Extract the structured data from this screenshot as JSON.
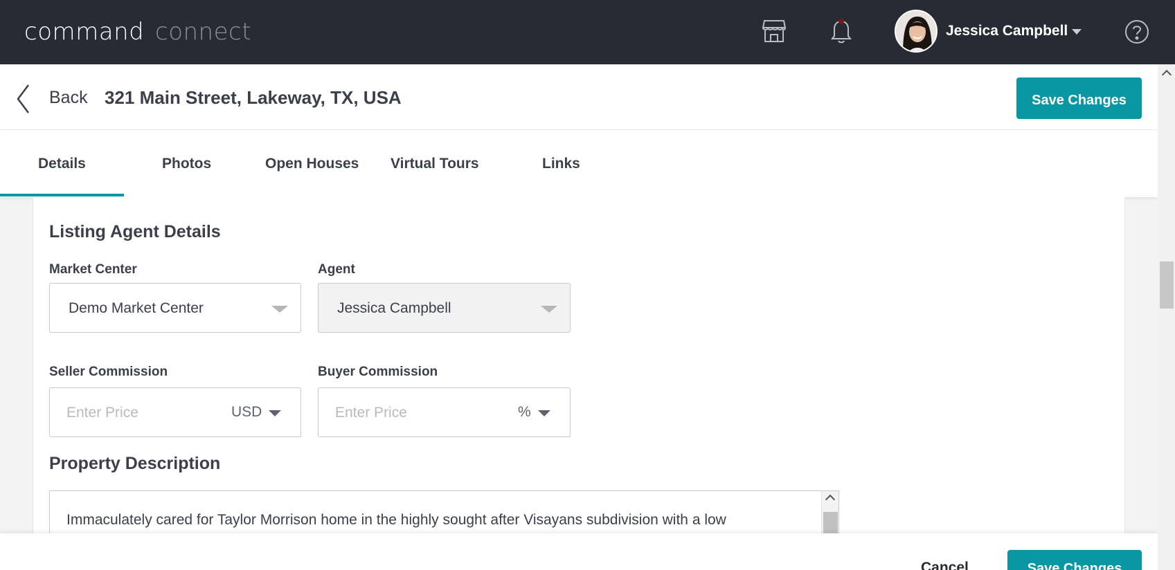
{
  "topbar": {
    "brand_primary": "command",
    "brand_secondary": "connect",
    "user_name": "Jessica Campbell"
  },
  "header": {
    "back_label": "Back",
    "address": "321 Main Street, Lakeway, TX, USA",
    "save_label": "Save Changes"
  },
  "tabs": [
    {
      "label": "Details",
      "active": true
    },
    {
      "label": "Photos"
    },
    {
      "label": "Open Houses"
    },
    {
      "label": "Virtual Tours"
    },
    {
      "label": "Links"
    }
  ],
  "listing_agent": {
    "title": "Listing Agent Details",
    "market_center_label": "Market Center",
    "market_center_value": "Demo Market Center",
    "agent_label": "Agent",
    "agent_value": "Jessica Campbell",
    "seller_commission_label": "Seller Commission",
    "seller_commission_placeholder": "Enter Price",
    "seller_commission_unit": "USD",
    "buyer_commission_label": "Buyer Commission",
    "buyer_commission_placeholder": "Enter Price",
    "buyer_commission_unit": "%"
  },
  "property_description": {
    "title": "Property Description",
    "text": "Immaculately cared for Taylor Morrison home in the highly sought after Visayans subdivision with a low"
  },
  "footer": {
    "cancel_label": "Cancel",
    "save_label": "Save Changes"
  },
  "colors": {
    "topbar": "#272b33",
    "accent": "#0a97a4"
  }
}
